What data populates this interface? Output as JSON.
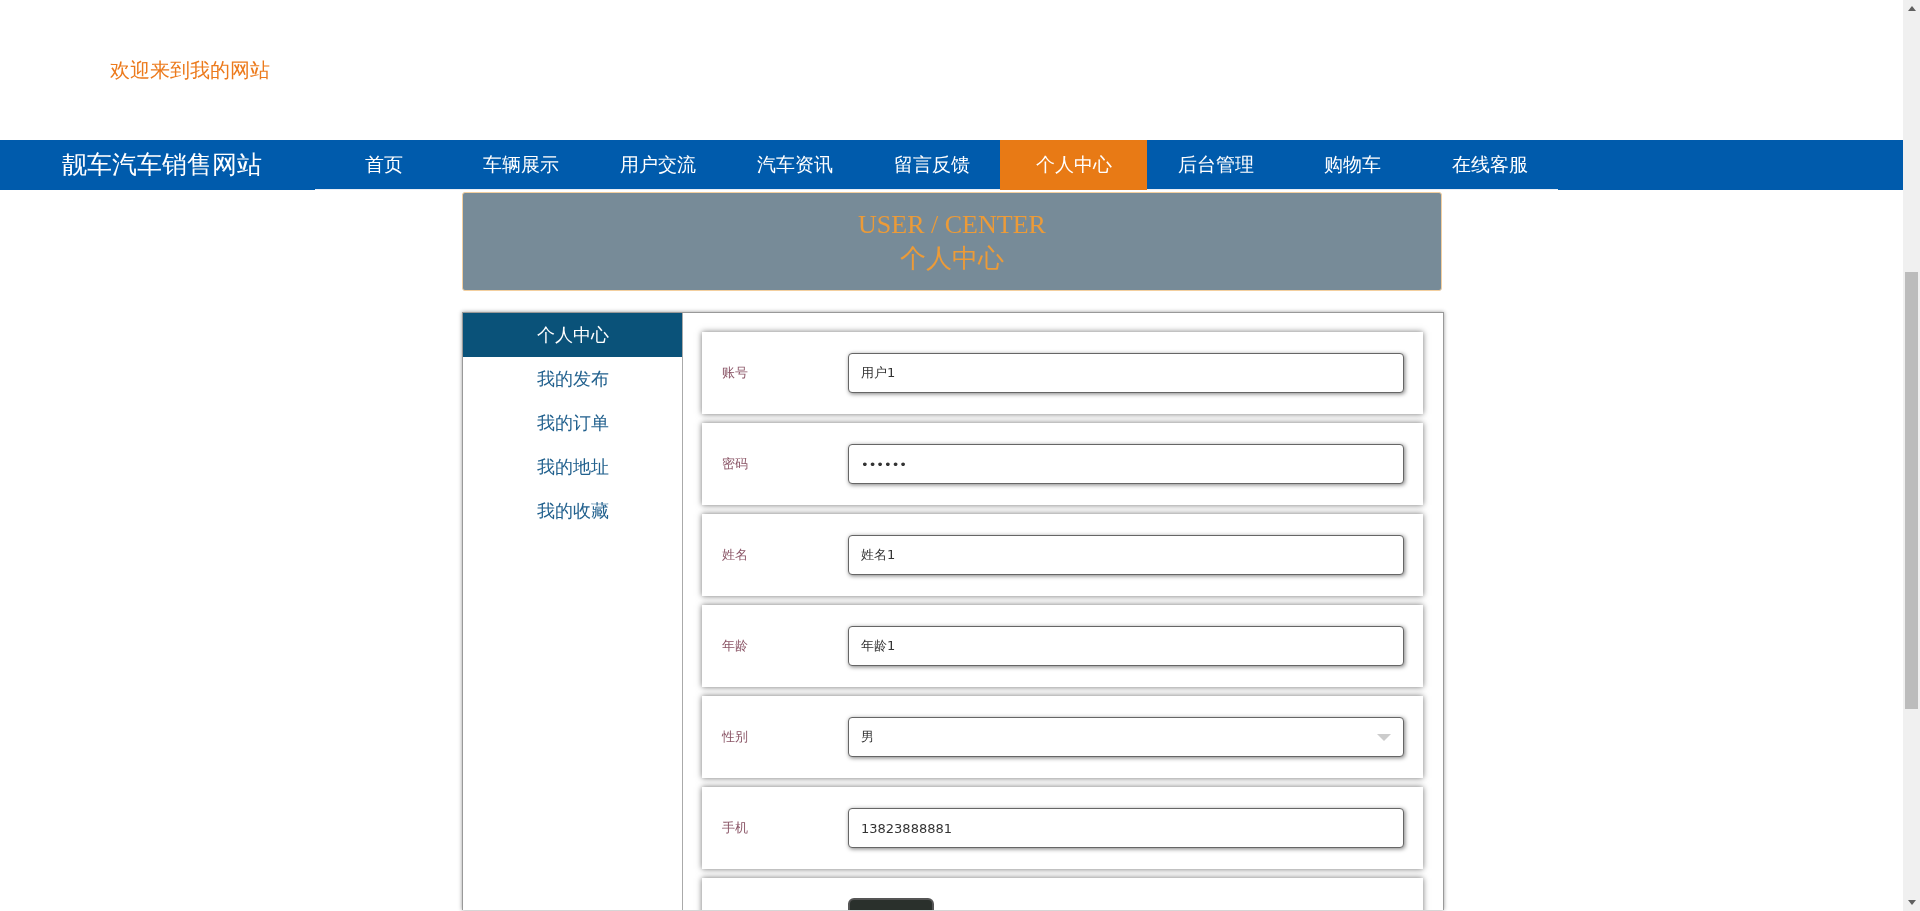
{
  "header": {
    "welcome": "欢迎来到我的网站"
  },
  "nav": {
    "brand": "靓车汽车销售网站",
    "items": [
      {
        "label": "首页",
        "selected": false
      },
      {
        "label": "车辆展示",
        "selected": false
      },
      {
        "label": "用户交流",
        "selected": false
      },
      {
        "label": "汽车资讯",
        "selected": false
      },
      {
        "label": "留言反馈",
        "selected": false
      },
      {
        "label": "个人中心",
        "selected": true
      },
      {
        "label": "后台管理",
        "selected": false
      },
      {
        "label": "购物车",
        "selected": false
      },
      {
        "label": "在线客服",
        "selected": false
      }
    ]
  },
  "banner": {
    "title_en": "USER / CENTER",
    "title_cn": "个人中心"
  },
  "sidebar": {
    "items": [
      {
        "label": "个人中心",
        "selected": true
      },
      {
        "label": "我的发布",
        "selected": false
      },
      {
        "label": "我的订单",
        "selected": false
      },
      {
        "label": "我的地址",
        "selected": false
      },
      {
        "label": "我的收藏",
        "selected": false
      }
    ]
  },
  "form": {
    "fields": [
      {
        "kind": "text",
        "label": "账号",
        "value": "用户1"
      },
      {
        "kind": "text",
        "label": "密码",
        "value": "••••••"
      },
      {
        "kind": "text",
        "label": "姓名",
        "value": "姓名1"
      },
      {
        "kind": "text",
        "label": "年龄",
        "value": "年龄1"
      },
      {
        "kind": "select",
        "label": "性别",
        "value": "男"
      },
      {
        "kind": "text",
        "label": "手机",
        "value": "13823888881"
      },
      {
        "kind": "photo"
      }
    ]
  }
}
